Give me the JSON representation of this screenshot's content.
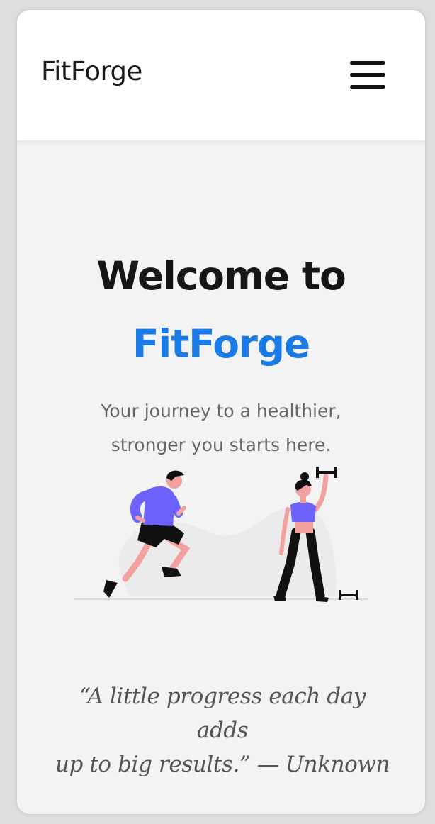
{
  "header": {
    "brand": "FitForge",
    "menu_icon": "hamburger-menu-icon"
  },
  "hero": {
    "welcome": "Welcome to",
    "brand_highlight": "FitForge",
    "tagline_line1": "Your journey to a healthier,",
    "tagline_line2": "stronger you starts here.",
    "illustration": "fitness-illustration"
  },
  "quote": {
    "line1": "“A little progress each day adds",
    "line2": "up to big results.” — Unknown"
  },
  "colors": {
    "accent": "#1a7ae6",
    "figure_top": "#6c63ff",
    "skin": "#f2a0a0",
    "dark": "#111111"
  }
}
